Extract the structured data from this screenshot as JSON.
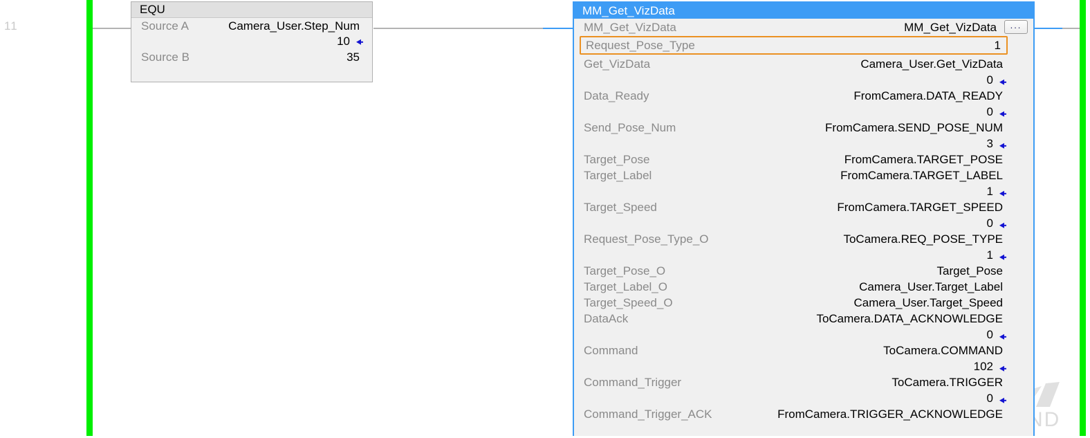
{
  "rung": {
    "number": "11"
  },
  "colors": {
    "rail_green": "#00ef00",
    "header_blue": "#3d9cf5",
    "selection_orange": "#eb9122",
    "value_marker_blue": "#1414d2",
    "label_gray": "#8a8a8a",
    "block_fill": "#f0f0f0"
  },
  "equ_block": {
    "title": "EQU",
    "rows": [
      {
        "label": "Source A",
        "tag": "Camera_User.Step_Num"
      },
      {
        "label": "",
        "value": "10",
        "marker": "left-arrow"
      },
      {
        "label": "Source B",
        "value": "35",
        "marker": ""
      }
    ]
  },
  "function_block": {
    "header_title": "MM_Get_VizData",
    "instance": {
      "label": "MM_Get_VizData",
      "tag": "MM_Get_VizData",
      "ellipsis_button": "..."
    },
    "selected_parameter": {
      "label": "Request_Pose_Type",
      "value": "1"
    },
    "parameters": [
      {
        "label": "Get_VizData",
        "tag": "Camera_User.Get_VizData",
        "value": "0"
      },
      {
        "label": "Data_Ready",
        "tag": "FromCamera.DATA_READY",
        "value": "0"
      },
      {
        "label": "Send_Pose_Num",
        "tag": "FromCamera.SEND_POSE_NUM",
        "value": "3"
      },
      {
        "label": "Target_Pose",
        "tag": "FromCamera.TARGET_POSE",
        "value": ""
      },
      {
        "label": "Target_Label",
        "tag": "FromCamera.TARGET_LABEL",
        "value": "1"
      },
      {
        "label": "Target_Speed",
        "tag": "FromCamera.TARGET_SPEED",
        "value": "0"
      },
      {
        "label": "Request_Pose_Type_O",
        "tag": "ToCamera.REQ_POSE_TYPE",
        "value": "1"
      },
      {
        "label": "Target_Pose_O",
        "tag": "Target_Pose",
        "value": ""
      },
      {
        "label": "Target_Label_O",
        "tag": "Camera_User.Target_Label",
        "value": ""
      },
      {
        "label": "Target_Speed_O",
        "tag": "Camera_User.Target_Speed",
        "value": ""
      },
      {
        "label": "DataAck",
        "tag": "ToCamera.DATA_ACKNOWLEDGE",
        "value": "0"
      },
      {
        "label": "Command",
        "tag": "ToCamera.COMMAND",
        "value": "102"
      },
      {
        "label": "Command_Trigger",
        "tag": "ToCamera.TRIGGER",
        "value": "0"
      },
      {
        "label": "Command_Trigger_ACK",
        "tag": "FromCamera.TRIGGER_ACKNOWLEDGE",
        "value": ""
      }
    ]
  },
  "watermark": {
    "text": "MECH MIND"
  }
}
